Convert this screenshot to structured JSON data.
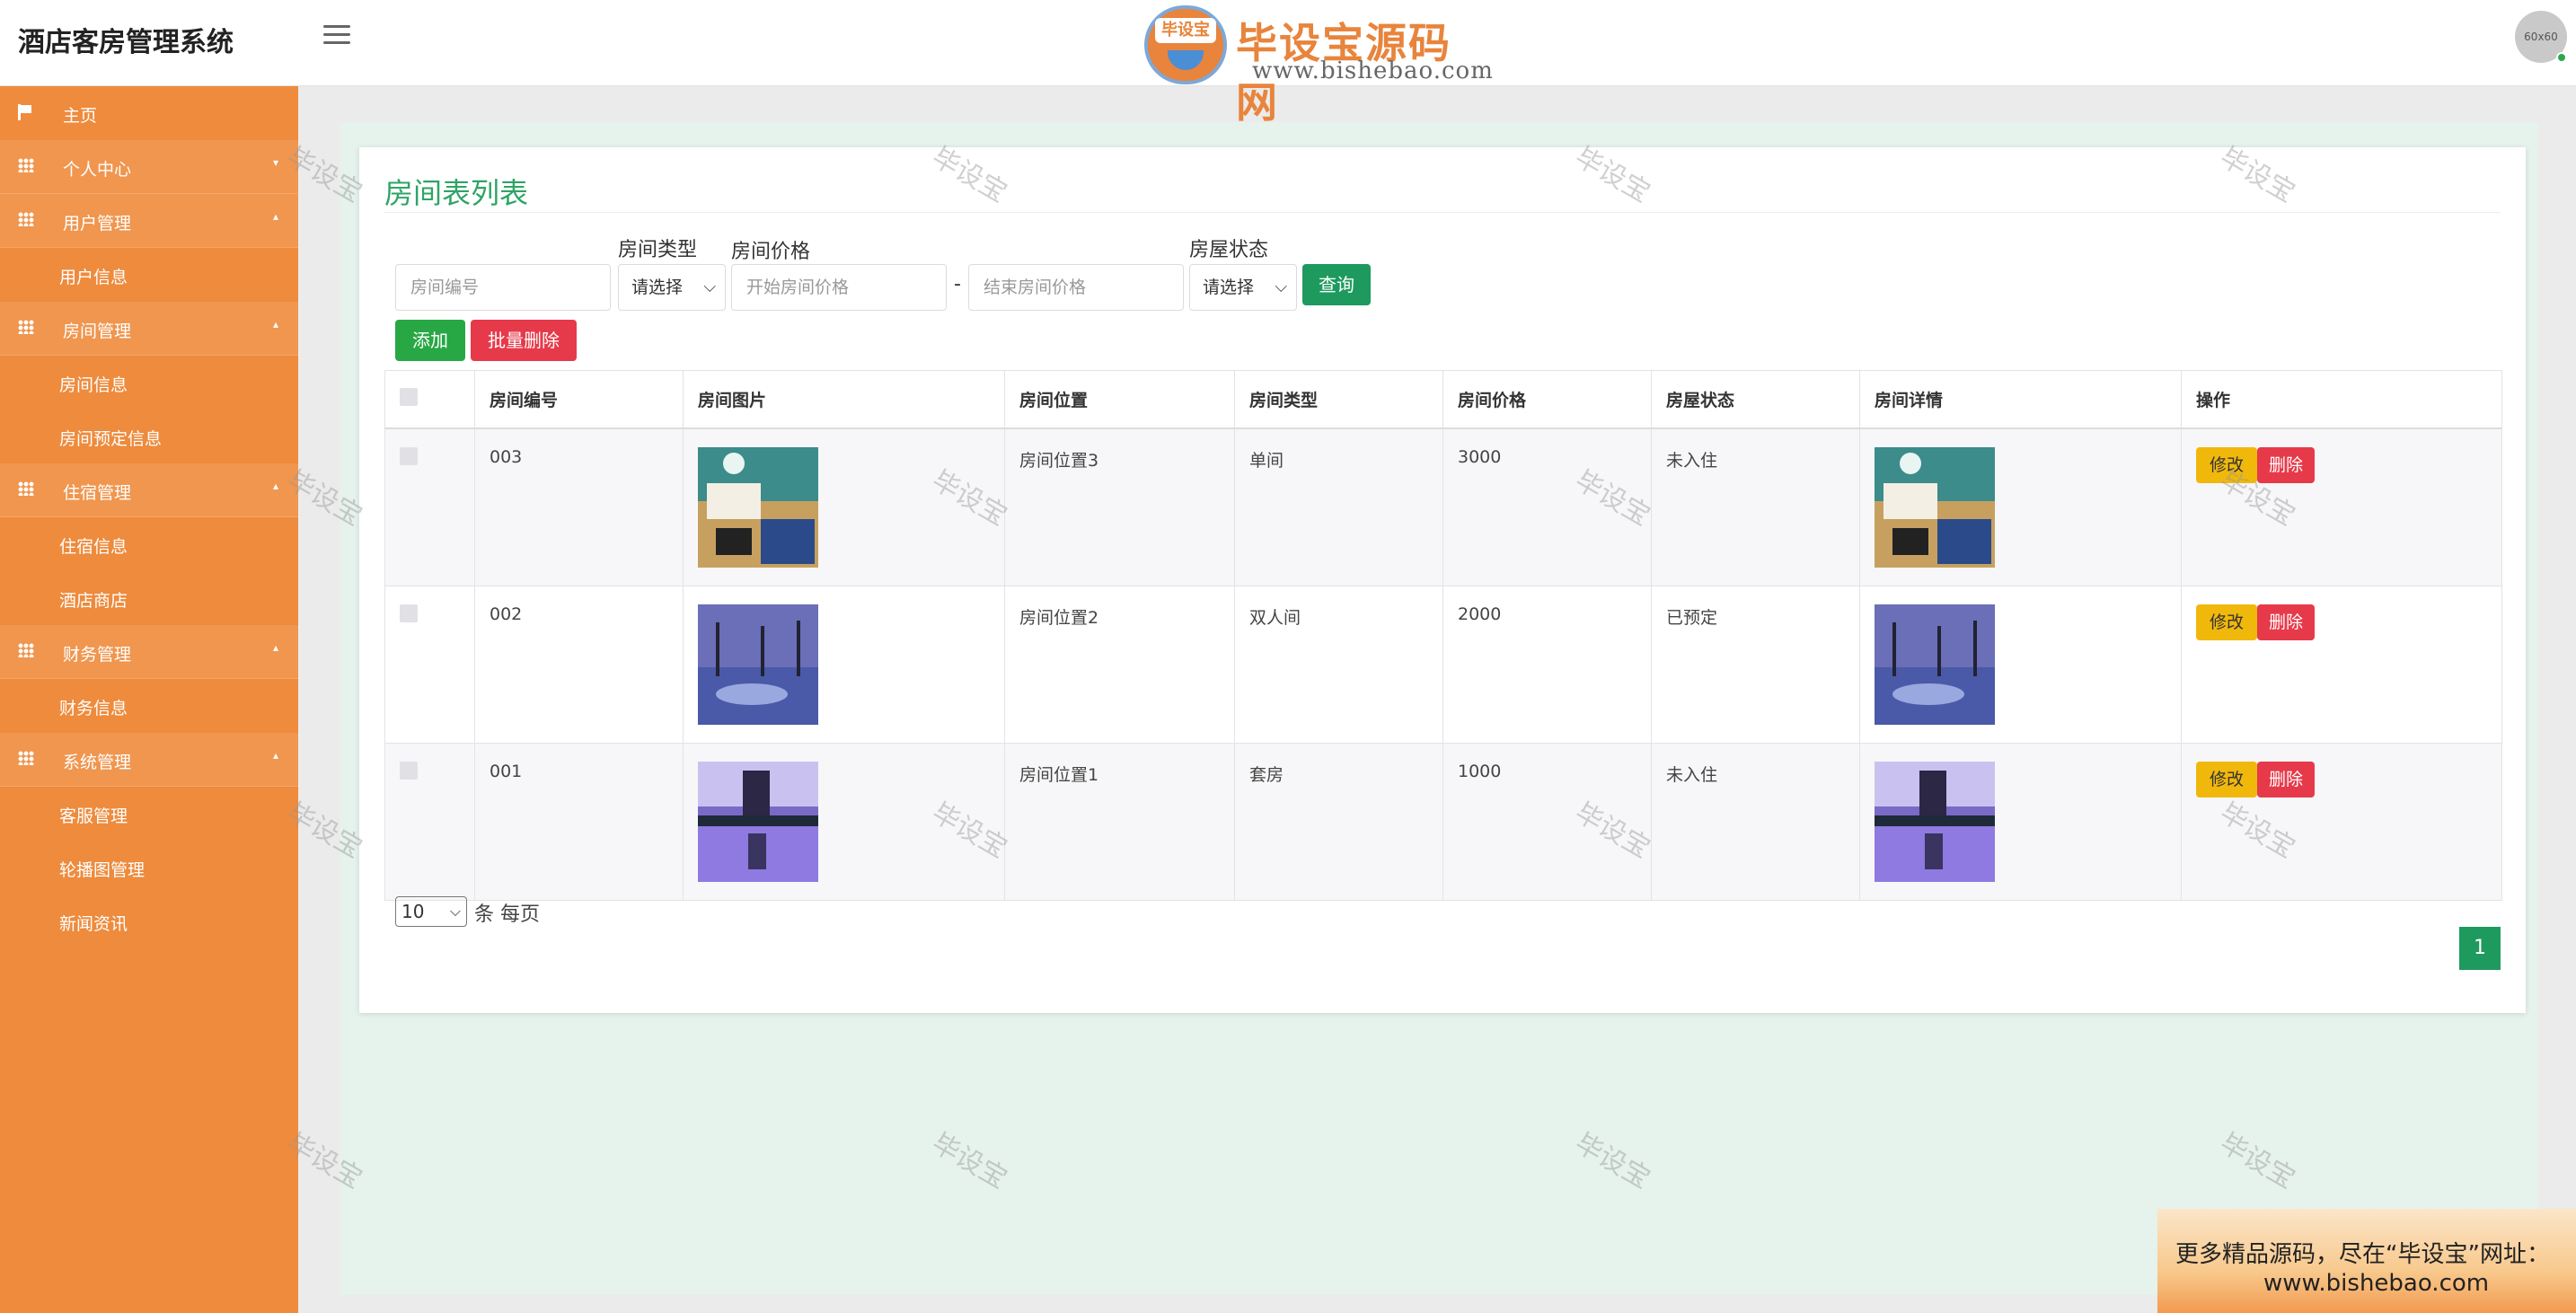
{
  "header": {
    "app_title": "酒店客房管理系统",
    "logo_text": "毕设宝源码网",
    "logo_url": "www.bishebao.com",
    "logo_badge": "毕设宝",
    "avatar_text": "60x60"
  },
  "sidebar": {
    "home": "主页",
    "groups": [
      {
        "label": "个人中心",
        "items": []
      },
      {
        "label": "用户管理",
        "items": [
          "用户信息"
        ]
      },
      {
        "label": "房间管理",
        "items": [
          "房间信息",
          "房间预定信息"
        ]
      },
      {
        "label": "住宿管理",
        "items": [
          "住宿信息",
          "酒店商店"
        ]
      },
      {
        "label": "财务管理",
        "items": [
          "财务信息"
        ]
      },
      {
        "label": "系统管理",
        "items": [
          "客服管理",
          "轮播图管理",
          "新闻资讯"
        ]
      }
    ]
  },
  "main": {
    "page_title": "房间表列表",
    "filters": {
      "room_no_placeholder": "房间编号",
      "room_type_label": "房间类型",
      "room_type_value": "请选择",
      "price_label": "房间价格",
      "price_start_placeholder": "开始房间价格",
      "price_sep": "-",
      "price_end_placeholder": "结束房间价格",
      "status_label": "房屋状态",
      "status_value": "请选择",
      "search_button": "查询"
    },
    "add_button": "添加",
    "batch_delete_button": "批量删除",
    "table": {
      "columns": [
        "房间编号",
        "房间图片",
        "房间位置",
        "房间类型",
        "房间价格",
        "房屋状态",
        "房间详情",
        "操作"
      ],
      "rows": [
        {
          "room_no": "003",
          "location": "房间位置3",
          "type": "单间",
          "price": "3000",
          "status": "未入住"
        },
        {
          "room_no": "002",
          "location": "房间位置2",
          "type": "双人间",
          "price": "2000",
          "status": "已预定"
        },
        {
          "room_no": "001",
          "location": "房间位置1",
          "type": "套房",
          "price": "1000",
          "status": "未入住"
        }
      ],
      "edit_label": "修改",
      "delete_label": "删除"
    },
    "pagination": {
      "page_size": "10",
      "page_size_suffix": "条 每页",
      "current_page": "1"
    }
  },
  "watermark": "毕设宝",
  "ad": {
    "line1": "更多精品源码，尽在“毕设宝”网址：",
    "line2": "www.bishebao.com"
  },
  "colors": {
    "sidebar": "#ee8b3d",
    "accent_green": "#1e9a5e",
    "title_green": "#2fa466",
    "danger": "#e63a4a",
    "warning": "#f1b80c"
  }
}
